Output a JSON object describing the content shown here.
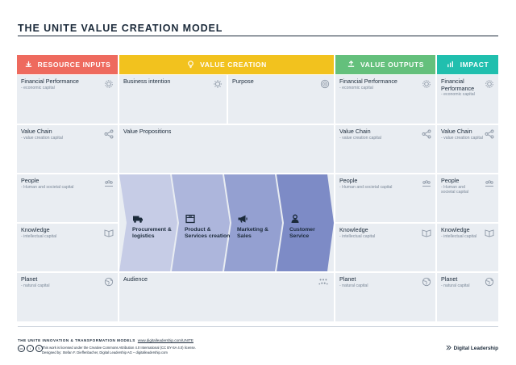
{
  "title": {
    "prefix": "THE UNITE ",
    "main": "VALUE CREATION MODEL"
  },
  "colors": {
    "resource": "#ee6a5e",
    "value_creation": "#f2c21e",
    "outputs": "#64c07c",
    "impact": "#20bfae",
    "cell": "#e9edf2"
  },
  "headers": {
    "resource_inputs": {
      "label": "RESOURCE INPUTS",
      "icon": "resource-icon"
    },
    "value_creation": {
      "label": "VALUE CREATION",
      "icon": "lightbulb-icon"
    },
    "value_outputs": {
      "label": "VALUE OUTPUTS",
      "icon": "outputs-icon"
    },
    "impact": {
      "label": "IMPACT",
      "icon": "impact-icon"
    }
  },
  "resource": {
    "financial": {
      "title": "Financial Performance",
      "sub": "- economic capital",
      "icon": "gear-icon"
    },
    "value_chain": {
      "title": "Value Chain",
      "sub": "- value creation capital",
      "icon": "share-icon"
    },
    "people": {
      "title": "People",
      "sub": "- Human and societal capital",
      "icon": "people-icon"
    },
    "knowledge": {
      "title": "Knowledge",
      "sub": "- intellectual capital",
      "icon": "book-icon"
    },
    "planet": {
      "title": "Planet",
      "sub": "- natural capital",
      "icon": "globe-icon"
    }
  },
  "creation": {
    "business_intention": {
      "title": "Business intention",
      "icon": "lightbulb-icon"
    },
    "purpose": {
      "title": "Purpose",
      "icon": "target-icon"
    },
    "value_propositions": {
      "title": "Value Propositions"
    },
    "audience": {
      "title": "Audience",
      "icon": "audience-icon"
    },
    "chevrons": [
      {
        "line1": "Procurement &",
        "line2": "logistics",
        "icon": "truck-icon"
      },
      {
        "line1": "Product &",
        "line2": "Services creation",
        "icon": "box-icon"
      },
      {
        "line1": "Marketing &",
        "line2": "Sales",
        "icon": "megaphone-icon"
      },
      {
        "line1": "Customer",
        "line2": "Service",
        "icon": "user-icon"
      }
    ]
  },
  "outputs": {
    "financial": {
      "title": "Financial Performance",
      "sub": "- economic capital",
      "icon": "gear-icon"
    },
    "value_chain": {
      "title": "Value Chain",
      "sub": "- value creation capital",
      "icon": "share-icon"
    },
    "people": {
      "title": "People",
      "sub": "- Human and societal capital",
      "icon": "people-icon"
    },
    "knowledge": {
      "title": "Knowledge",
      "sub": "- intellectual capital",
      "icon": "book-icon"
    },
    "planet": {
      "title": "Planet",
      "sub": "- natural capital",
      "icon": "globe-icon"
    }
  },
  "impact": {
    "financial": {
      "title1": "Financial",
      "title2": "Performance",
      "sub": "- economic capital",
      "icon": "gear-icon"
    },
    "value_chain": {
      "title": "Value Chain",
      "sub": "- value creation capital",
      "icon": "share-icon"
    },
    "people": {
      "title": "People",
      "sub1": "- Human and",
      "sub2": "societal capital",
      "icon": "people-icon"
    },
    "knowledge": {
      "title": "Knowledge",
      "sub": "- intellectual capital",
      "icon": "book-icon"
    },
    "planet": {
      "title": "Planet",
      "sub": "- natural capital",
      "icon": "globe-icon"
    }
  },
  "footer": {
    "series": "THE UNITE INNOVATION & TRANSFORMATION MODELS",
    "url": "www.digitalleadership.com/UNITE",
    "license": "This work is licensed under the Creative Commons Attribution 4.0 International (CC BY-SA 4.0) license.",
    "designer": "Designed by: Stefan F. Dieffenbacher, Digital Leadership AG – digitalleadership.com",
    "brand": "Digital Leadership"
  }
}
